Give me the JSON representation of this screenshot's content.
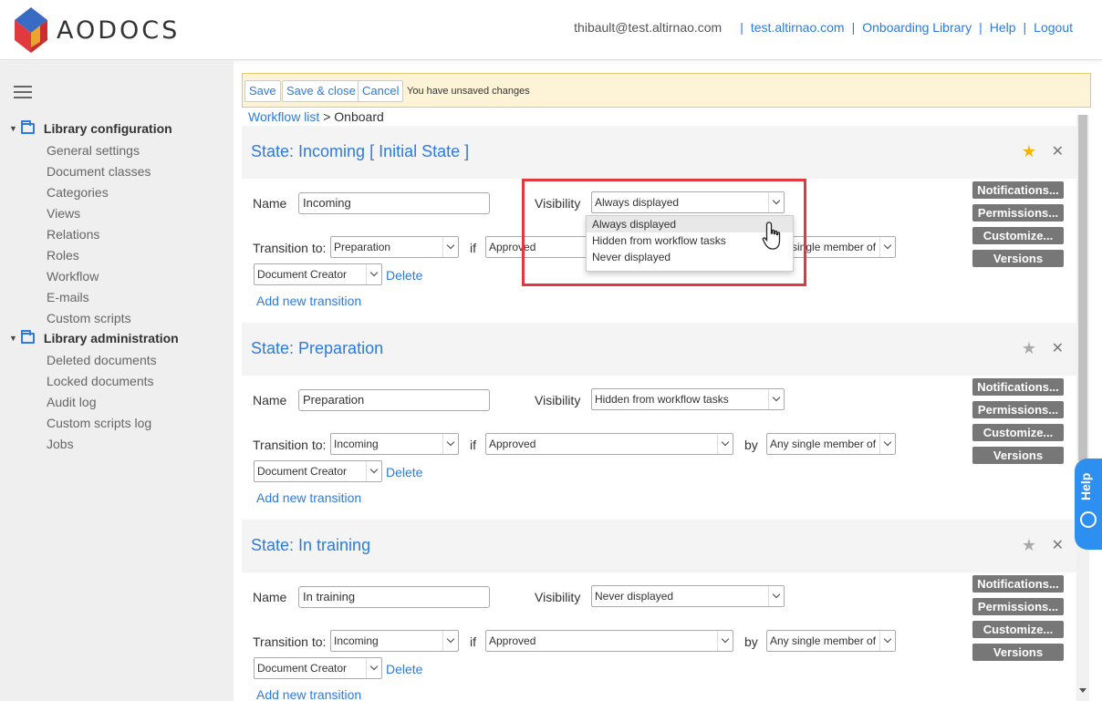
{
  "brand": {
    "name": "AODOCS"
  },
  "top_nav": {
    "user": "thibault@test.altirnao.com",
    "domain": "test.altirnao.com",
    "library": "Onboarding Library",
    "help": "Help",
    "logout": "Logout",
    "separator": "|"
  },
  "sidebar": {
    "groups": [
      {
        "label": "Library configuration",
        "items": [
          "General settings",
          "Document classes",
          "Categories",
          "Views",
          "Relations",
          "Roles",
          "Workflow",
          "E-mails",
          "Custom scripts"
        ]
      },
      {
        "label": "Library administration",
        "items": [
          "Deleted documents",
          "Locked documents",
          "Audit log",
          "Custom scripts log",
          "Jobs"
        ]
      }
    ]
  },
  "toolbar": {
    "save": "Save",
    "save_close": "Save & close",
    "cancel": "Cancel",
    "unsaved": "You have unsaved changes"
  },
  "breadcrumb": {
    "link": "Workflow list",
    "separator": ">",
    "current": "Onboard"
  },
  "labels": {
    "name": "Name",
    "visibility": "Visibility",
    "transition_to": "Transition to:",
    "if": "if",
    "by": "by",
    "delete": "Delete",
    "add_transition": "Add new transition"
  },
  "side_buttons": [
    "Notifications...",
    "Permissions...",
    "Customize...",
    "Versions"
  ],
  "states": [
    {
      "title": "State: Incoming [ Initial State ]",
      "starred": true,
      "name": "Incoming",
      "visibility": "Always displayed",
      "transition_to": "Preparation",
      "condition": "Approved",
      "by": "Any single member of",
      "role": "Document Creator"
    },
    {
      "title": "State: Preparation",
      "starred": false,
      "name": "Preparation",
      "visibility": "Hidden from workflow tasks",
      "transition_to": "Incoming",
      "condition": "Approved",
      "by": "Any single member of",
      "role": "Document Creator"
    },
    {
      "title": "State: In training",
      "starred": false,
      "name": "In training",
      "visibility": "Never displayed",
      "transition_to": "Incoming",
      "condition": "Approved",
      "by": "Any single member of",
      "role": "Document Creator"
    }
  ],
  "visibility_dropdown": {
    "options": [
      "Always displayed",
      "Hidden from workflow tasks",
      "Never displayed"
    ],
    "hovered": "Always displayed"
  },
  "help_tab": {
    "label": "Help"
  },
  "colors": {
    "accent": "#2d7be0",
    "star_active": "#f5b400",
    "highlight": "#e0393e",
    "warning_bg": "#fdf4d8"
  }
}
